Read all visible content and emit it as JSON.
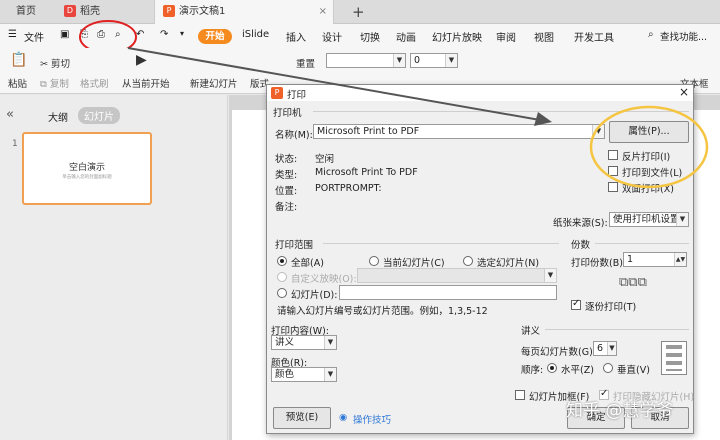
{
  "tabs": [
    {
      "label": "首页"
    },
    {
      "label": "稻壳"
    },
    {
      "label": "演示文稿1"
    }
  ],
  "tab_add": "+",
  "menu": {
    "file": "文件",
    "start": "开始",
    "items": [
      "iSlide",
      "插入",
      "设计",
      "切换",
      "动画",
      "幻灯片放映",
      "审阅",
      "视图",
      "开发工具"
    ],
    "search": "查找功能..."
  },
  "ribbon": {
    "paste": "粘贴",
    "cut": "剪切",
    "copy": "复制",
    "format_painter": "格式刷",
    "from_current": "从当前开始",
    "new_slide": "新建幻灯片",
    "layout": "版式",
    "reset": "重置",
    "font_size": "0",
    "text_box": "文本框"
  },
  "sidebar": {
    "outline": "大纲",
    "slides": "幻灯片",
    "slide_number": "1",
    "thumb_title": "空白演示",
    "thumb_sub": "单击输入您的封面副标题"
  },
  "dialog": {
    "title": "打印",
    "printer_group": "打印机",
    "name_label": "名称(M):",
    "printer_name": "Microsoft Print to PDF",
    "properties_button": "属性(P)...",
    "status_label": "状态:",
    "status_value": "空闲",
    "type_label": "类型:",
    "type_value": "Microsoft Print To PDF",
    "location_label": "位置:",
    "location_value": "PORTPROMPT:",
    "note_label": "备注:",
    "reverse_print": "反片打印(I)",
    "print_to_file": "打印到文件(L)",
    "duplex": "双面打印(X)",
    "paper_source_label": "纸张来源(S):",
    "paper_source_value": "使用打印机设置",
    "range_group": "打印范围",
    "range_all": "全部(A)",
    "range_current": "当前幻灯片(C)",
    "range_selected": "选定幻灯片(N)",
    "range_custom": "自定义放映(O):",
    "range_slides": "幻灯片(D):",
    "range_hint": "请输入幻灯片编号或幻灯片范围。例如，1,3,5-12",
    "copies_group": "份数",
    "copies_label": "打印份数(B):",
    "copies_value": "1",
    "collate": "逐份打印(T)",
    "content_label": "打印内容(W):",
    "content_value": "讲义",
    "color_label": "颜色(R):",
    "color_value": "颜色",
    "handout_group": "讲义",
    "per_page_label": "每页幻灯片数(G):",
    "per_page_value": "6",
    "order_label": "顺序:",
    "order_horizontal": "水平(Z)",
    "order_vertical": "垂直(V)",
    "frame_slides": "幻灯片加框(F)",
    "print_hidden": "打印隐藏幻灯片(H)",
    "preview_button": "预览(E)",
    "tips_link": "操作技巧",
    "ok_button": "确定",
    "cancel_button": "取消"
  },
  "watermark": "知乎 @慧学爷",
  "colors": {
    "accent": "#f58a1f",
    "annotation": "#e02020",
    "highlight": "#f5c542"
  }
}
